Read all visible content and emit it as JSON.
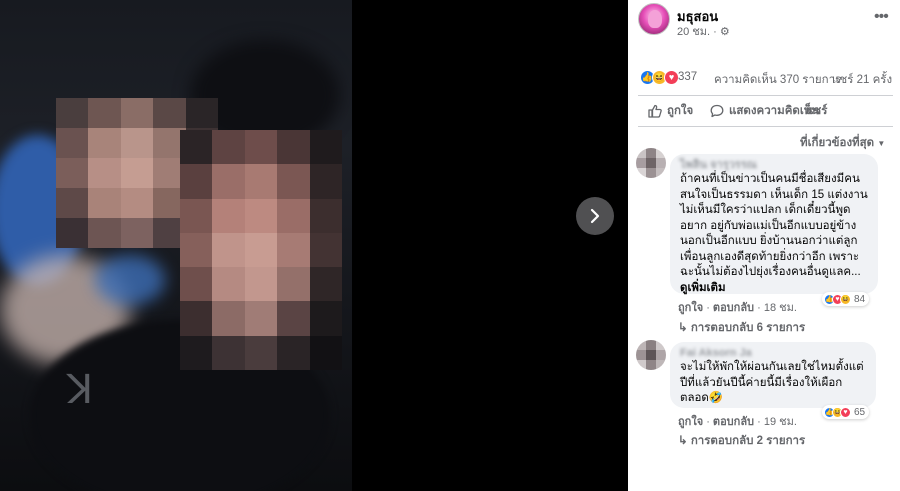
{
  "post": {
    "page_name": "มธุสอน",
    "time": "20 ชม. · ⚙",
    "more_label": "•••"
  },
  "stats": {
    "reactions": "337",
    "comments": "ความคิดเห็น 370 รายการ",
    "shares": "แชร์ 21 ครั้ง"
  },
  "actions": {
    "like": "ถูกใจ",
    "comment": "แสดงความคิดเห็น",
    "share": "แชร์"
  },
  "sort_label": "ที่เกี่ยวข้องที่สุด",
  "comments": [
    {
      "author": "ไพลิน จารุวรรณ",
      "text": "ถ้าคนที่เป็นข่าวเป็นคนมีชื่อเสียงมีคนสนใจเป็นธรรมดา เห็นเด็ก 15 แต่งงานไม่เห็นมีใครว่าแปลก เด็กเดี๋ยวนี้พูดอยาก อยู่กับพ่อแม่เป็นอีกแบบอยู่ข้างนอกเป็นอีกแบบ ยิ่งบ้านนอกว่าแต่ลูกเพื่อนลูกเองดีสุดท้ายยิ่งกว่าอีก เพราะฉะนั้นไม่ต้องไปยุ่งเรื่องคนอื่นดูแลค...",
      "see_more": "ดูเพิ่มเติม",
      "like": "ถูกใจ",
      "reply": "ตอบกลับ",
      "time": "18 ชม.",
      "reaction_count": "84",
      "replies": "↳ การตอบกลับ 6 รายการ"
    },
    {
      "author": "Fai Aksorn Ja",
      "text": "จะไม่ให้พักให้ผ่อนกันเลยใช่ไหมตั้งแต่ปีที่แล้วยันปีนี้ค่ายนี้มีเรื่องให้เผือกตลอด🤣",
      "like": "ถูกใจ",
      "reply": "ตอบกลับ",
      "time": "19 ชม.",
      "reaction_count": "65",
      "replies": "↳ การตอบกลับ 2 รายการ"
    }
  ],
  "colors": {
    "viewer_bg": "#000000",
    "accent": "#1877f2",
    "muted_text": "#65676b",
    "bubble_bg": "#f0f2f5"
  },
  "icons": [
    "chevron-right-icon",
    "like-icon",
    "comment-icon",
    "share-icon",
    "more-icon",
    "settings-icon"
  ]
}
